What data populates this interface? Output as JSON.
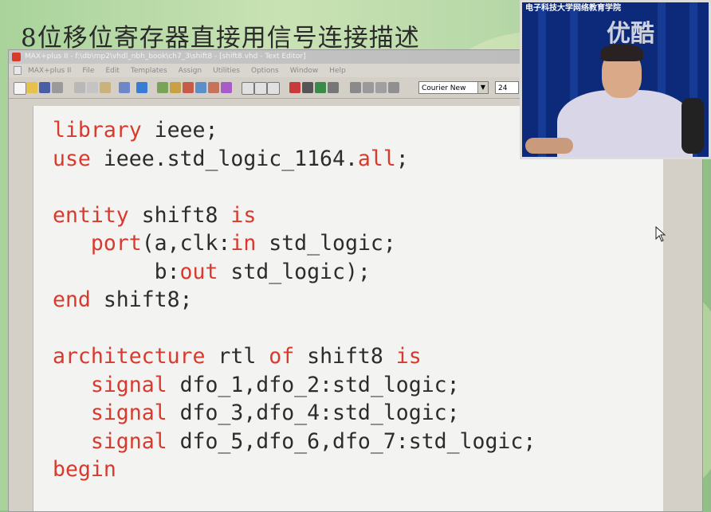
{
  "slide": {
    "title": "8位移位寄存器直接用信号连接描述"
  },
  "app": {
    "window_title": "MAX+plus II - f:\\db\\mp2\\vhdl_nbh_book\\ch7_3\\shift8 - [shift8.vhd - Text Editor]",
    "menu": [
      "MAX+plus II",
      "File",
      "Edit",
      "Templates",
      "Assign",
      "Utilities",
      "Options",
      "Window",
      "Help"
    ],
    "font_select": "Courier New",
    "font_size": "24"
  },
  "code": {
    "lines": [
      [
        {
          "t": "library",
          "k": true
        },
        {
          "t": " ieee;",
          "k": false
        }
      ],
      [
        {
          "t": "use",
          "k": true
        },
        {
          "t": " ieee.std_logic_1164.",
          "k": false
        },
        {
          "t": "all",
          "k": true
        },
        {
          "t": ";",
          "k": false
        }
      ],
      [],
      [
        {
          "t": "entity",
          "k": true
        },
        {
          "t": " shift8 ",
          "k": false
        },
        {
          "t": "is",
          "k": true
        }
      ],
      [
        {
          "t": "   ",
          "k": false
        },
        {
          "t": "port",
          "k": true
        },
        {
          "t": "(a,clk:",
          "k": false
        },
        {
          "t": "in",
          "k": true
        },
        {
          "t": " std_logic;",
          "k": false
        }
      ],
      [
        {
          "t": "        b:",
          "k": false
        },
        {
          "t": "out",
          "k": true
        },
        {
          "t": " std_logic);",
          "k": false
        }
      ],
      [
        {
          "t": "end",
          "k": true
        },
        {
          "t": " shift8;",
          "k": false
        }
      ],
      [],
      [
        {
          "t": "architecture",
          "k": true
        },
        {
          "t": " rtl ",
          "k": false
        },
        {
          "t": "of",
          "k": true
        },
        {
          "t": " shift8 ",
          "k": false
        },
        {
          "t": "is",
          "k": true
        }
      ],
      [
        {
          "t": "   ",
          "k": false
        },
        {
          "t": "signal",
          "k": true
        },
        {
          "t": " dfo_1,dfo_2:std_logic;",
          "k": false
        }
      ],
      [
        {
          "t": "   ",
          "k": false
        },
        {
          "t": "signal",
          "k": true
        },
        {
          "t": " dfo_3,dfo_4:std_logic;",
          "k": false
        }
      ],
      [
        {
          "t": "   ",
          "k": false
        },
        {
          "t": "signal",
          "k": true
        },
        {
          "t": " dfo_5,dfo_6,dfo_7:std_logic;",
          "k": false
        }
      ],
      [
        {
          "t": "begin",
          "k": true
        }
      ]
    ]
  },
  "video": {
    "caption": "电子科技大学网络教育学院",
    "watermark": "优酷"
  },
  "colors": {
    "keyword": "#d83a2d",
    "code_text": "#2c2c2c",
    "editor_bg": "#f3f3f1"
  }
}
